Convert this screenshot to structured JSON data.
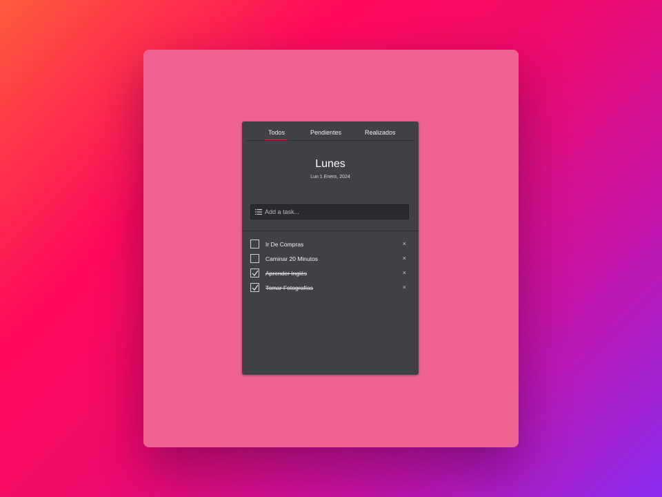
{
  "tabs": [
    {
      "label": "Todos",
      "active": true
    },
    {
      "label": "Pendientes",
      "active": false
    },
    {
      "label": "Realizados",
      "active": false
    }
  ],
  "day": {
    "title": "Lunes",
    "date": "Lun 1 Enero, 2024"
  },
  "add_task": {
    "placeholder": "Add a task...",
    "icon": "list-icon"
  },
  "tasks": [
    {
      "label": "Ir De Compras",
      "done": false
    },
    {
      "label": "Caminar 20 Minutos",
      "done": false
    },
    {
      "label": "Aprender Inglés",
      "done": true
    },
    {
      "label": "Tomar Fotografías",
      "done": true
    }
  ],
  "delete_symbol": "×",
  "colors": {
    "app_bg": "#404145",
    "frame_bg": "#ef6392",
    "tab_accent": "#e0243c"
  }
}
